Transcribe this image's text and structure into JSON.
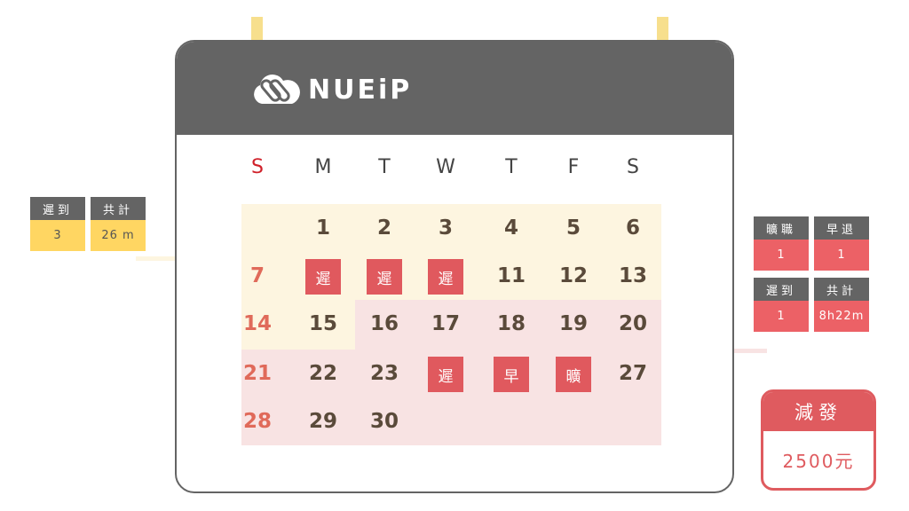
{
  "brand": {
    "name": "NUEiP"
  },
  "colors": {
    "header": "#646464",
    "accent_red": "#e0595e",
    "yellow": "#ffd662",
    "pin": "#f7df8d",
    "week_yellow_bg": "#fdf5e0",
    "week_pink_bg": "#f8e3e3"
  },
  "weekdays": [
    "S",
    "M",
    "T",
    "W",
    "T",
    "F",
    "S"
  ],
  "calendar": {
    "rows": [
      [
        "",
        "1",
        "2",
        "3",
        "4",
        "5",
        "6"
      ],
      [
        "7",
        "遲",
        "遲",
        "遲",
        "11",
        "12",
        "13"
      ],
      [
        "14",
        "15",
        "16",
        "17",
        "18",
        "19",
        "20"
      ],
      [
        "21",
        "22",
        "23",
        "遲",
        "早",
        "曠",
        "27"
      ],
      [
        "28",
        "29",
        "30",
        "",
        "",
        "",
        ""
      ]
    ]
  },
  "left_stats": [
    {
      "label": "遲到",
      "value": "3"
    },
    {
      "label": "共計",
      "value": "26 m"
    }
  ],
  "right_stats": [
    {
      "label": "曠職",
      "value": "1"
    },
    {
      "label": "早退",
      "value": "1"
    },
    {
      "label": "遲到",
      "value": "1"
    },
    {
      "label": "共計",
      "value": "8h22m"
    }
  ],
  "deduction": {
    "label": "減發",
    "value": "2500元"
  }
}
